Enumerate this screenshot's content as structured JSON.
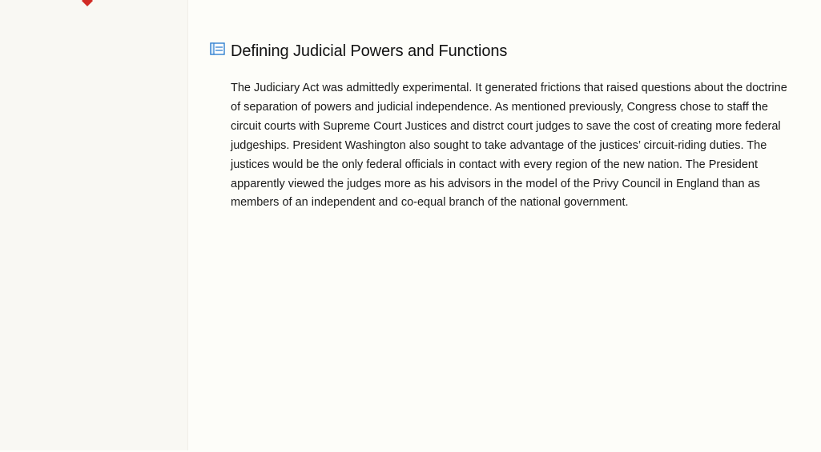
{
  "sidebar": {
    "marker_icon": "red-diamond-icon",
    "marker_color": "#d22b25"
  },
  "section": {
    "icon": "note-icon",
    "icon_color": "#2f7fd0",
    "title": "Defining Judicial Powers and Functions",
    "paragraph": "The Judiciary Act was admittedly experimental. It generated frictions that raised questions about the doctrine of separation of powers and judicial independence. As mentioned previously, Congress chose to staff the circuit courts with Supreme Court Justices and distrct court judges to save the cost of creating more federal judgeships. President Washington also sought to take advantage of the justices’ circuit-riding duties. The justices would be the only federal officials in contact with every region of the new nation. The President apparently viewed the judges more as his advisors in the model of the Privy Council in England than as members of an independent and co-equal branch of the national government."
  }
}
